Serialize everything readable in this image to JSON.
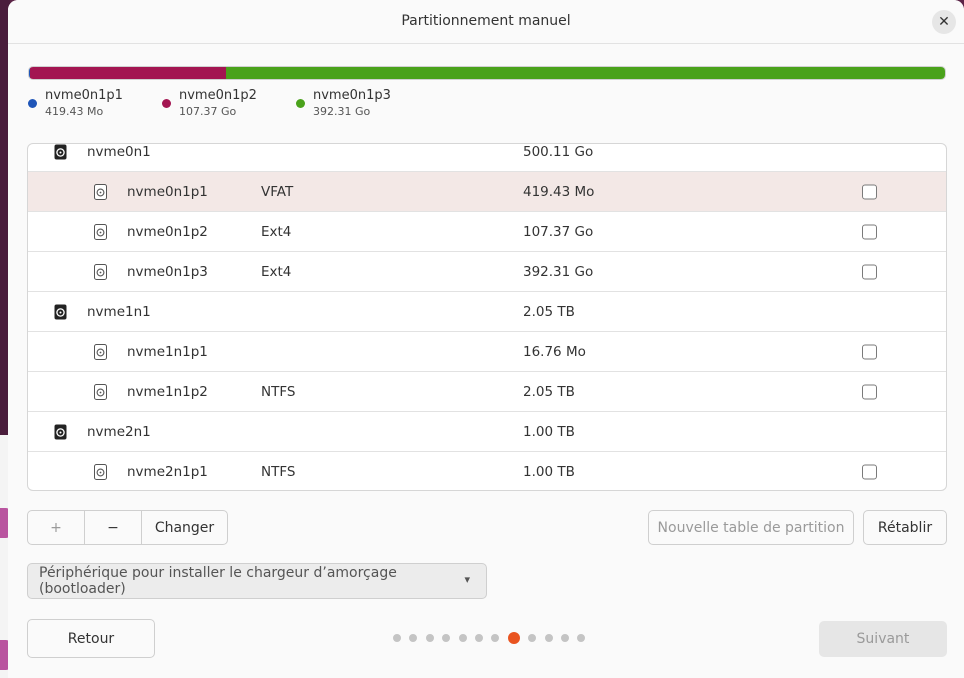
{
  "window": {
    "title": "Partitionnement manuel"
  },
  "colors": {
    "p1": "#1f55b8",
    "p2": "#a31551",
    "p3": "#4aa21b",
    "accent": "#e95420"
  },
  "usage": [
    {
      "name": "nvme0n1p1",
      "size": "419.43 Mo",
      "fraction": 0.0008
    },
    {
      "name": "nvme0n1p2",
      "size": "107.37 Go",
      "fraction": 0.2147
    },
    {
      "name": "nvme0n1p3",
      "size": "392.31 Go",
      "fraction": 0.7845
    }
  ],
  "rows": [
    {
      "type": "disk",
      "name": "nvme0n1",
      "fs": "",
      "size": "500.11 Go",
      "check": false
    },
    {
      "type": "part",
      "name": "nvme0n1p1",
      "fs": "VFAT",
      "size": "419.43 Mo",
      "check": true,
      "selected": true
    },
    {
      "type": "part",
      "name": "nvme0n1p2",
      "fs": "Ext4",
      "size": "107.37 Go",
      "check": true
    },
    {
      "type": "part",
      "name": "nvme0n1p3",
      "fs": "Ext4",
      "size": "392.31 Go",
      "check": true
    },
    {
      "type": "disk",
      "name": "nvme1n1",
      "fs": "",
      "size": "2.05 TB",
      "check": false
    },
    {
      "type": "part",
      "name": "nvme1n1p1",
      "fs": "",
      "size": "16.76 Mo",
      "check": true
    },
    {
      "type": "part",
      "name": "nvme1n1p2",
      "fs": "NTFS",
      "size": "2.05 TB",
      "check": true
    },
    {
      "type": "disk",
      "name": "nvme2n1",
      "fs": "",
      "size": "1.00 TB",
      "check": false
    },
    {
      "type": "part",
      "name": "nvme2n1p1",
      "fs": "NTFS",
      "size": "1.00 TB",
      "check": true
    }
  ],
  "toolbar": {
    "add_label": "+",
    "remove_label": "−",
    "change_label": "Changer",
    "new_table_label": "Nouvelle table de partition",
    "revert_label": "Rétablir"
  },
  "bootloader": {
    "placeholder": "Périphérique pour installer le chargeur d’amorçage (bootloader)",
    "arrow": "▾"
  },
  "footer": {
    "back_label": "Retour",
    "next_label": "Suivant",
    "steps_total": 12,
    "step_current": 8
  }
}
